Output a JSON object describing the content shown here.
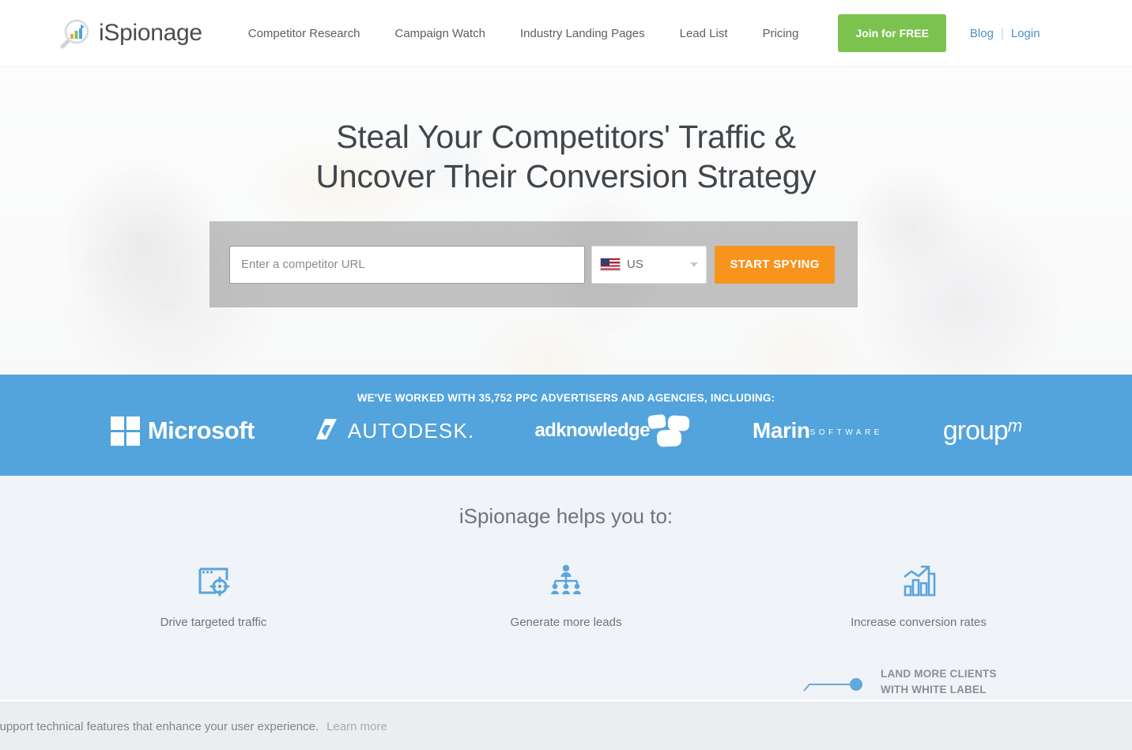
{
  "header": {
    "brand": "iSpionage",
    "logo_icon": "magnifier-chart-logo",
    "nav": [
      {
        "label": "Competitor Research"
      },
      {
        "label": "Campaign Watch"
      },
      {
        "label": "Industry Landing Pages"
      },
      {
        "label": "Lead List"
      },
      {
        "label": "Pricing"
      }
    ],
    "join_label": "Join for FREE",
    "blog_label": "Blog",
    "separator": "|",
    "login_label": "Login",
    "colors": {
      "join_green": "#7cc24f",
      "link_blue": "#4a90c4"
    }
  },
  "hero": {
    "title_line1": "Steal Your Competitors' Traffic &",
    "title_line2": "Uncover Their Conversion Strategy",
    "search": {
      "url_placeholder": "Enter a competitor URL",
      "url_value": "",
      "country_code": "US",
      "country_flag": "us-flag-icon",
      "caret_icon": "chevron-down-icon",
      "submit_label": "START SPYING",
      "submit_color": "#f7941e"
    }
  },
  "partners": {
    "title": "WE'VE WORKED WITH 35,752 PPC ADVERTISERS AND AGENCIES, INCLUDING:",
    "band_color": "#53a3dc",
    "logos": [
      {
        "name": "microsoft-logo",
        "text": "Microsoft"
      },
      {
        "name": "autodesk-logo",
        "text": "AUTODESK."
      },
      {
        "name": "adknowledge-logo",
        "text": "adknowledge"
      },
      {
        "name": "marin-software-logo",
        "text": "Marin",
        "subtext": "SOFTWARE"
      },
      {
        "name": "groupm-logo",
        "text": "group",
        "superscript": "m"
      }
    ]
  },
  "features": {
    "title": "iSpionage helps you to:",
    "items": [
      {
        "icon": "browser-target-icon",
        "label": "Drive targeted traffic"
      },
      {
        "icon": "org-chart-people-icon",
        "label": "Generate more leads"
      },
      {
        "icon": "bar-chart-arrow-icon",
        "label": "Increase conversion rates"
      }
    ]
  },
  "white_label": {
    "icon": "trend-line-dot-icon",
    "line1": "LAND MORE CLIENTS",
    "line2": "WITH WHITE LABEL"
  },
  "cookie_bar": {
    "text": "support technical features that enhance your user experience.",
    "link_label": "Learn more"
  }
}
